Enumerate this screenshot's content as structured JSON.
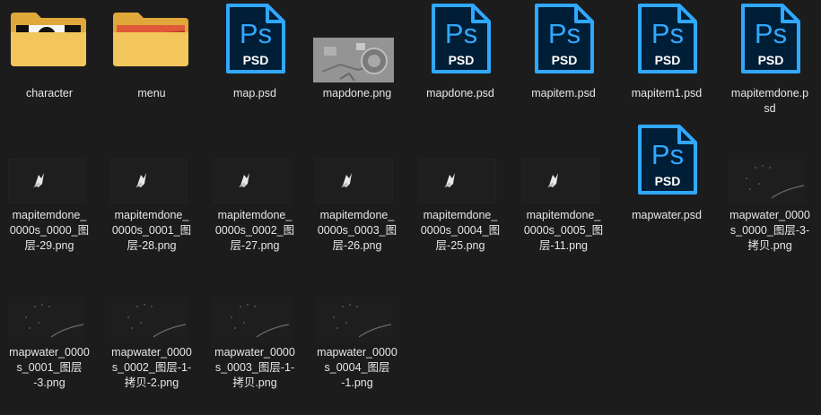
{
  "colors": {
    "background": "#1c1c1c",
    "label_text": "#e6e6e6",
    "ps_badge_bg": "#001e36",
    "ps_accent": "#31a8ff",
    "folder_yellow": "#f2c65a",
    "folder_back": "#e0a83a"
  },
  "files": [
    {
      "name": "character",
      "icon": "folder-icon-character"
    },
    {
      "name": "menu",
      "icon": "folder-icon-menu"
    },
    {
      "name": "map.psd",
      "icon": "photoshop-psd-icon"
    },
    {
      "name": "mapdone.png",
      "icon": "map-image-thumbnail"
    },
    {
      "name": "mapdone.psd",
      "icon": "photoshop-psd-icon"
    },
    {
      "name": "mapitem.psd",
      "icon": "photoshop-psd-icon"
    },
    {
      "name": "mapitem1.psd",
      "icon": "photoshop-psd-icon"
    },
    {
      "name": "mapitemdone.p\nsd",
      "icon": "photoshop-psd-icon"
    },
    {
      "name": "mapitemdone_\n0000s_0000_图\n层-29.png",
      "icon": "sprite-thumbnail"
    },
    {
      "name": "mapitemdone_\n0000s_0001_图\n层-28.png",
      "icon": "sprite-thumbnail"
    },
    {
      "name": "mapitemdone_\n0000s_0002_图\n层-27.png",
      "icon": "sprite-thumbnail"
    },
    {
      "name": "mapitemdone_\n0000s_0003_图\n层-26.png",
      "icon": "sprite-thumbnail"
    },
    {
      "name": "mapitemdone_\n0000s_0004_图\n层-25.png",
      "icon": "sprite-thumbnail"
    },
    {
      "name": "mapitemdone_\n0000s_0005_图\n层-11.png",
      "icon": "sprite-thumbnail"
    },
    {
      "name": "mapwater.psd",
      "icon": "photoshop-psd-icon"
    },
    {
      "name": "mapwater_0000\ns_0000_图层-3-\n拷贝.png",
      "icon": "water-thumbnail"
    },
    {
      "name": "mapwater_0000\ns_0001_图层\n-3.png",
      "icon": "water-thumbnail"
    },
    {
      "name": "mapwater_0000\ns_0002_图层-1-\n拷贝-2.png",
      "icon": "water-thumbnail"
    },
    {
      "name": "mapwater_0000\ns_0003_图层-1-\n拷贝.png",
      "icon": "water-thumbnail"
    },
    {
      "name": "mapwater_0000\ns_0004_图层\n-1.png",
      "icon": "water-thumbnail"
    }
  ],
  "ps_icon_text": {
    "top": "Ps",
    "bottom": "PSD"
  }
}
